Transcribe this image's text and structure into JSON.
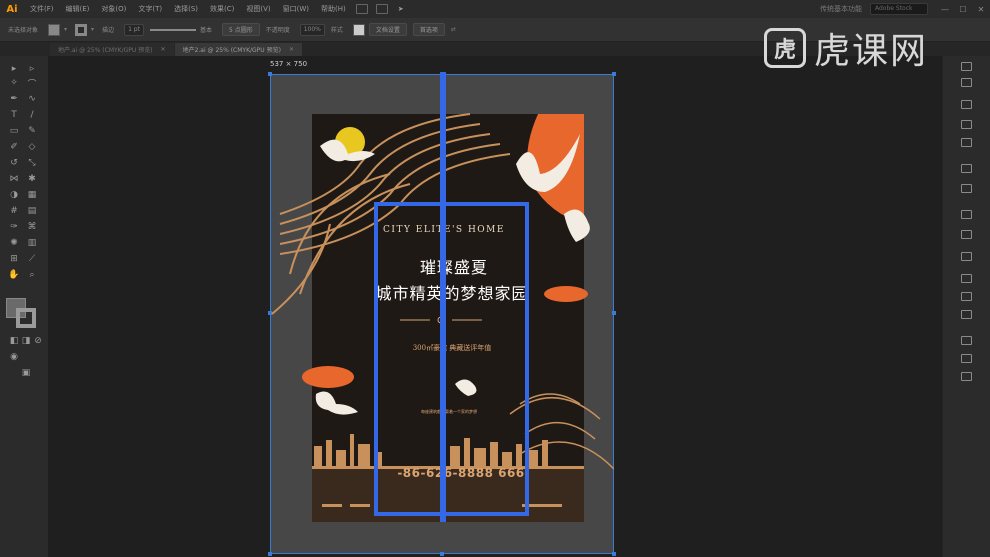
{
  "app": {
    "logo": "Ai",
    "menus": [
      "文件(F)",
      "编辑(E)",
      "对象(O)",
      "文字(T)",
      "选择(S)",
      "效果(C)",
      "视图(V)",
      "窗口(W)",
      "帮助(H)"
    ],
    "workspace": "传统基本功能",
    "search_placeholder": "Adobe Stock"
  },
  "control_bar": {
    "no_selection": "未选择对象",
    "stroke_label": "描边",
    "stroke_value": "1 pt",
    "stroke_style": "基本",
    "opacity_label": "等比",
    "opacity_value": "5 点圆形",
    "style_label": "不透明度",
    "opacity_percent": "100%",
    "style2": "样式",
    "doc_setup": "文档设置",
    "prefs": "首选项"
  },
  "tabs": [
    {
      "label": "地产.ai @ 25% (CMYK/GPU 预览)",
      "active": false
    },
    {
      "label": "地产2.ai @ 25% (CMYK/GPU 预览)",
      "active": true
    }
  ],
  "artboard": {
    "size_label": "537 × 750"
  },
  "poster": {
    "title_en": "CITY ELITE'S HOME",
    "title_line1": "璀璨盛夏",
    "title_line2": "城市精英的梦想家园",
    "subtitle": "300㎡豪宅 典藏送评年值",
    "small_text": "每座建筑都承载着一个家的梦想",
    "phone": "-86-626-8888 666"
  },
  "watermark": {
    "text": "虎课网",
    "logo_glyph": "虎"
  },
  "colors": {
    "accent_blue": "#3468e6",
    "poster_bg": "#1f1915",
    "orange": "#e8672c",
    "gold": "#d9a472"
  }
}
